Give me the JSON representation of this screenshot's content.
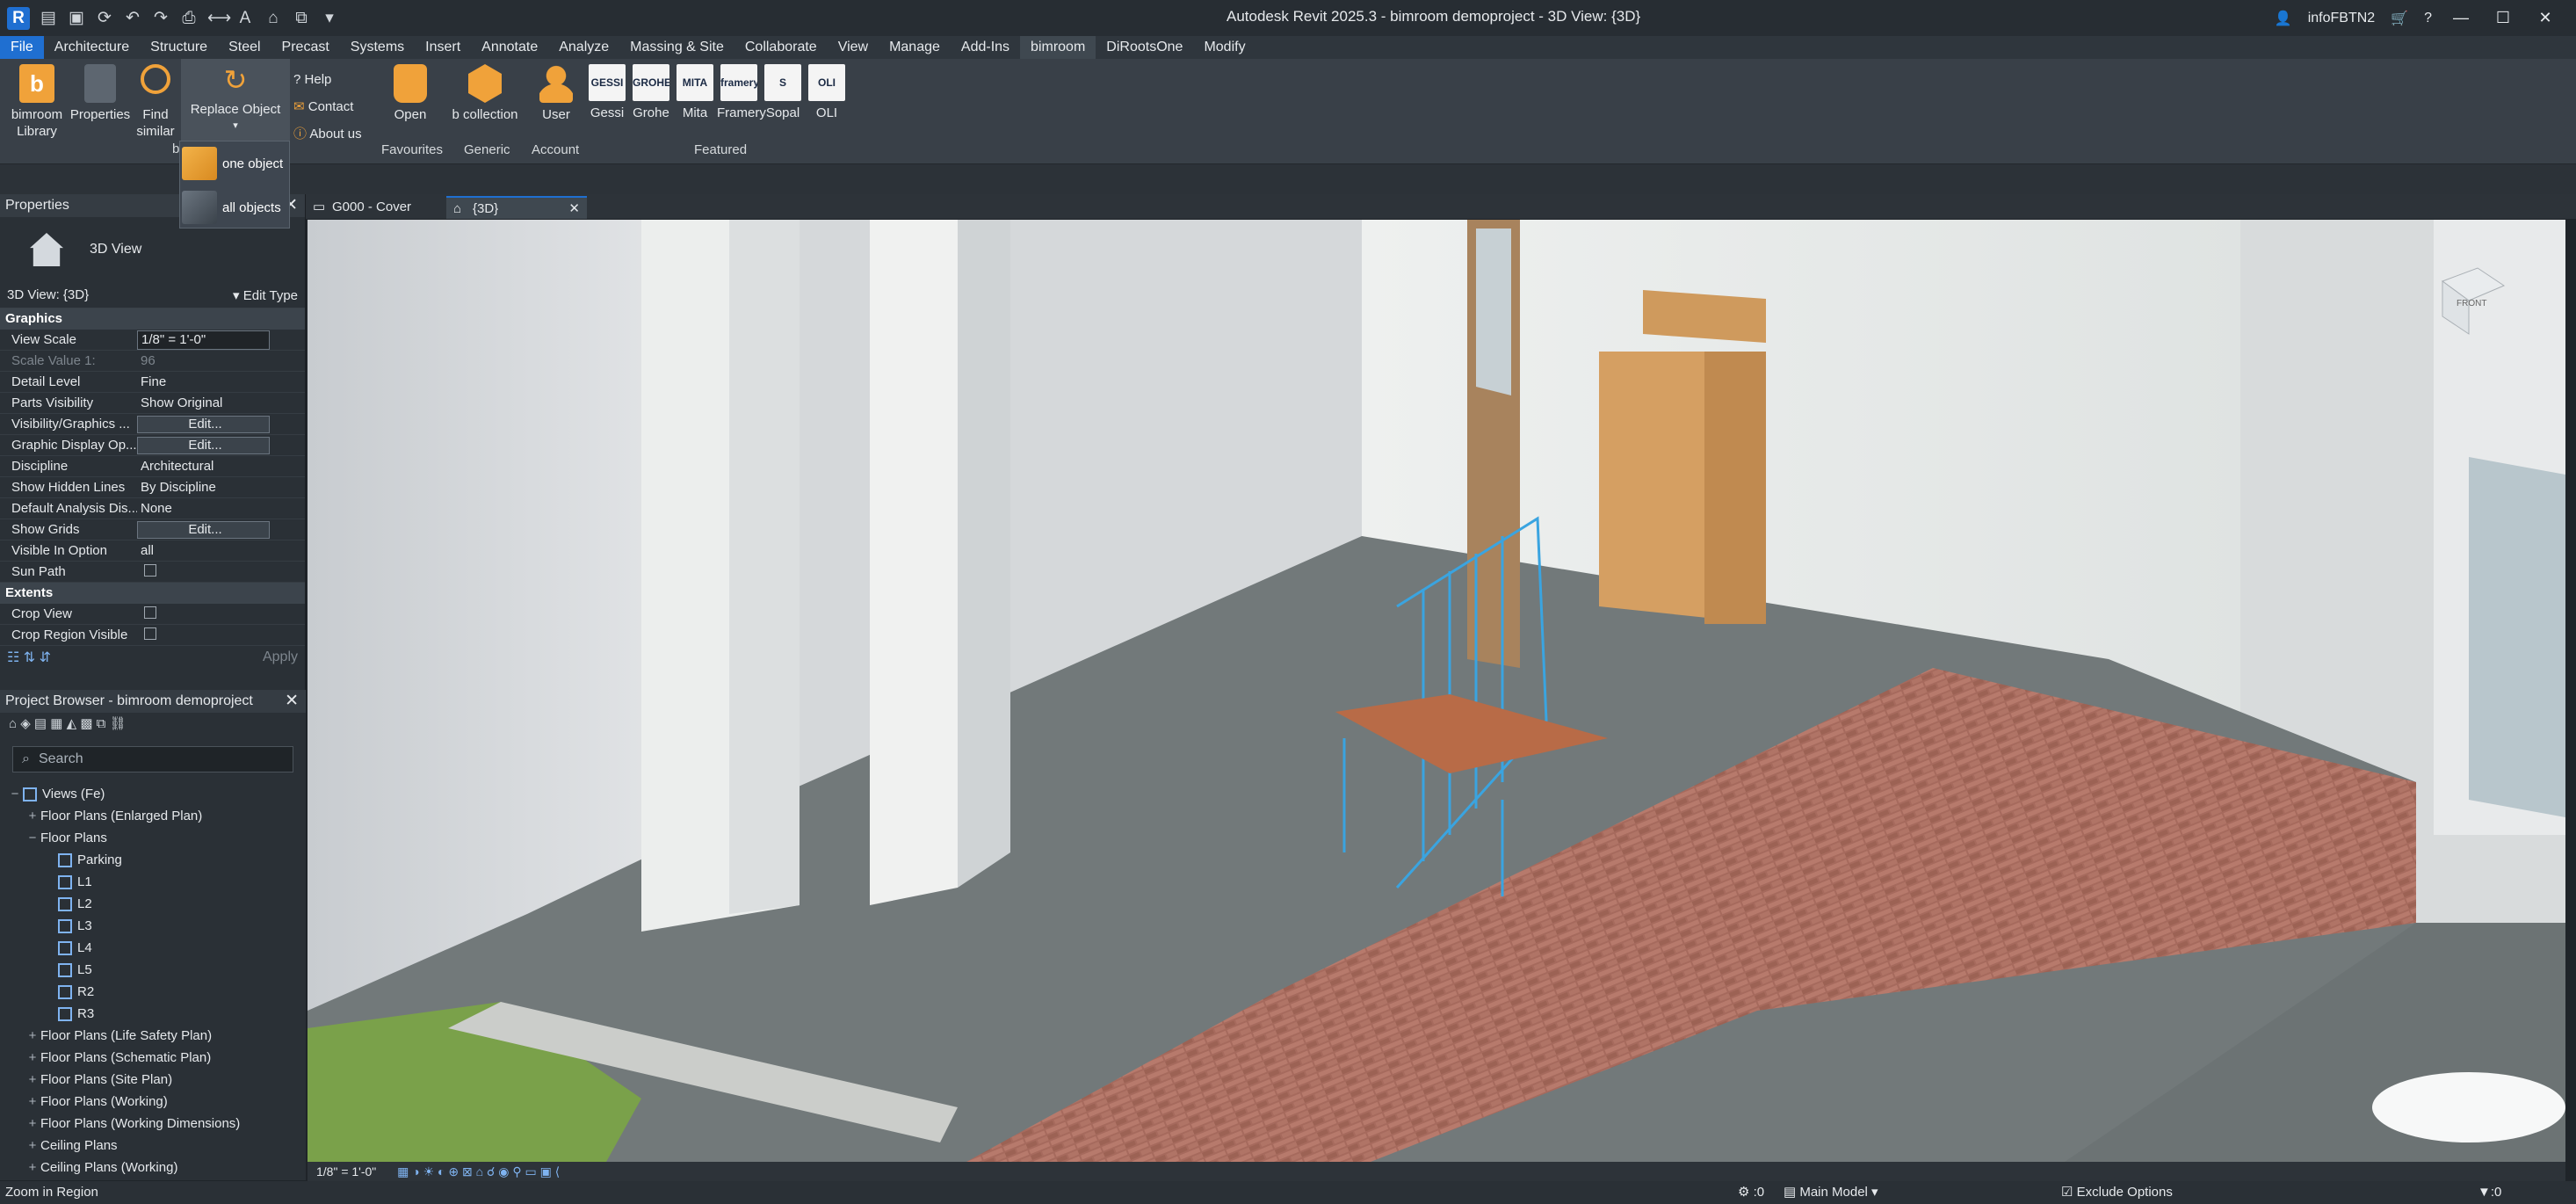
{
  "app": {
    "title": "Autodesk Revit 2025.3 - bimroom demoproject - 3D View: {3D}",
    "user": "infoFBTN2"
  },
  "tabs": [
    "File",
    "Architecture",
    "Structure",
    "Steel",
    "Precast",
    "Systems",
    "Insert",
    "Annotate",
    "Analyze",
    "Massing & Site",
    "Collaborate",
    "View",
    "Manage",
    "Add-Ins",
    "bimroom",
    "DiRootsOne",
    "Modify"
  ],
  "ribbon": {
    "bimroom_library": "bimroom Library",
    "properties": "Properties",
    "find_similar": "Find similar",
    "replace_object": "Replace Object",
    "help": "Help",
    "contact": "Contact",
    "about": "About us",
    "open": "Open",
    "b_collection": "b collection",
    "user": "User",
    "brands": [
      "Gessi",
      "Grohe",
      "Mita",
      "Framery",
      "Sopal",
      "OLI"
    ],
    "brand_logos": [
      "GESSI",
      "GROHE",
      "MITA",
      "framery",
      "S",
      "OLI"
    ],
    "panels": {
      "bim": "bim",
      "favourites": "Favourites",
      "generic": "Generic",
      "account": "Account",
      "featured": "Featured"
    }
  },
  "replace_menu": {
    "one": "one object",
    "all": "all objects"
  },
  "properties": {
    "title": "Properties",
    "type_name": "3D View",
    "view_selector": "3D View: {3D}",
    "edit_type": "Edit Type",
    "graphics_header": "Graphics",
    "rows": [
      {
        "k": "View Scale",
        "v": "1/8\" = 1'-0\""
      },
      {
        "k": "Scale Value    1:",
        "v": "96"
      },
      {
        "k": "Detail Level",
        "v": "Fine"
      },
      {
        "k": "Parts Visibility",
        "v": "Show Original"
      },
      {
        "k": "Visibility/Graphics ...",
        "v": "Edit..."
      },
      {
        "k": "Graphic Display Op...",
        "v": "Edit..."
      },
      {
        "k": "Discipline",
        "v": "Architectural"
      },
      {
        "k": "Show Hidden Lines",
        "v": "By Discipline"
      },
      {
        "k": "Default Analysis Dis...",
        "v": "None"
      },
      {
        "k": "Show Grids",
        "v": "Edit..."
      },
      {
        "k": "Visible In Option",
        "v": "all"
      },
      {
        "k": "Sun Path",
        "v": ""
      }
    ],
    "extents_header": "Extents",
    "extents_rows": [
      {
        "k": "Crop View",
        "v": ""
      },
      {
        "k": "Crop Region Visible",
        "v": ""
      }
    ],
    "apply": "Apply"
  },
  "browser": {
    "title": "Project Browser - bimroom demoproject",
    "search_placeholder": "Search",
    "tree": [
      {
        "indent": 0,
        "tog": "−",
        "label": "Views (Fe)",
        "icon": true
      },
      {
        "indent": 1,
        "tog": "+",
        "label": "Floor Plans (Enlarged Plan)"
      },
      {
        "indent": 1,
        "tog": "−",
        "label": "Floor Plans"
      },
      {
        "indent": 2,
        "tog": "",
        "label": "Parking",
        "icon": true
      },
      {
        "indent": 2,
        "tog": "",
        "label": "L1",
        "icon": true
      },
      {
        "indent": 2,
        "tog": "",
        "label": "L2",
        "icon": true
      },
      {
        "indent": 2,
        "tog": "",
        "label": "L3",
        "icon": true
      },
      {
        "indent": 2,
        "tog": "",
        "label": "L4",
        "icon": true
      },
      {
        "indent": 2,
        "tog": "",
        "label": "L5",
        "icon": true
      },
      {
        "indent": 2,
        "tog": "",
        "label": "R2",
        "icon": true
      },
      {
        "indent": 2,
        "tog": "",
        "label": "R3",
        "icon": true
      },
      {
        "indent": 1,
        "tog": "+",
        "label": "Floor Plans (Life Safety Plan)"
      },
      {
        "indent": 1,
        "tog": "+",
        "label": "Floor Plans (Schematic Plan)"
      },
      {
        "indent": 1,
        "tog": "+",
        "label": "Floor Plans (Site Plan)"
      },
      {
        "indent": 1,
        "tog": "+",
        "label": "Floor Plans (Working)"
      },
      {
        "indent": 1,
        "tog": "+",
        "label": "Floor Plans (Working Dimensions)"
      },
      {
        "indent": 1,
        "tog": "+",
        "label": "Ceiling Plans"
      },
      {
        "indent": 1,
        "tog": "+",
        "label": "Ceiling Plans (Working)"
      }
    ]
  },
  "view_tabs": [
    {
      "label": "G000 - Cover"
    },
    {
      "label": "{3D}"
    }
  ],
  "viewcube": "FRONT",
  "view_control": {
    "scale": "1/8\" = 1'-0\""
  },
  "status": {
    "left": "Zoom in Region",
    "model": "Main Model",
    "exclude": "Exclude Options",
    "sel0": ":0",
    "sel1": ":0",
    "filter": ":0"
  }
}
